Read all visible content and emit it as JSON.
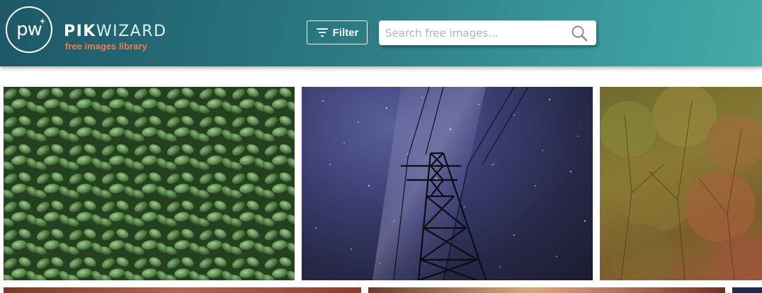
{
  "brand": {
    "logo_text": "pw",
    "name_bold": "PIK",
    "name_light": "WIZARD",
    "tagline": "free images library"
  },
  "header": {
    "filter_label": "Filter",
    "search_placeholder": "Search free images...",
    "search_value": ""
  },
  "icons": {
    "filter": "filter-lines-icon",
    "search": "magnifier-icon"
  },
  "colors": {
    "header_start": "#1d5866",
    "header_end": "#45aaa8",
    "tagline": "#f07c4a"
  },
  "gallery": {
    "photos": [
      {
        "subject": "green leafy shrub"
      },
      {
        "subject": "power pylon under milky way night sky"
      },
      {
        "subject": "autumn trees"
      },
      {
        "subject": "partial image"
      },
      {
        "subject": "partial image"
      },
      {
        "subject": "partial image"
      }
    ]
  }
}
